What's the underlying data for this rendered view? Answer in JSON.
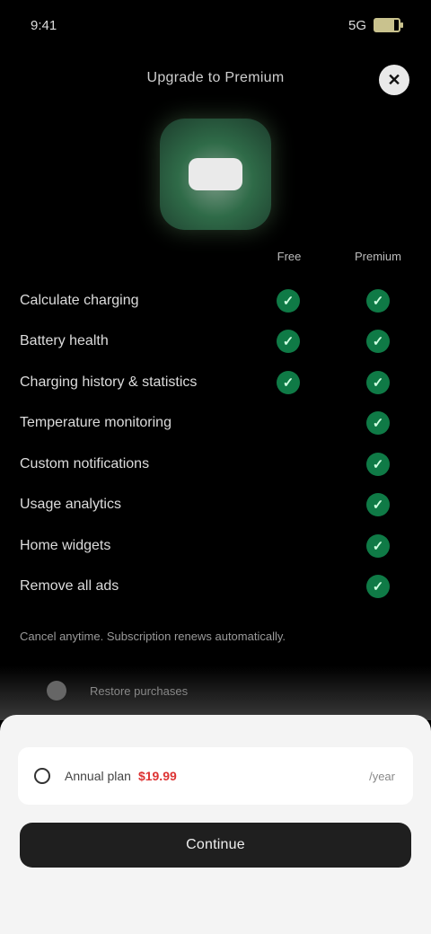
{
  "status_bar": {
    "time": "9:41",
    "signal": "5G",
    "battery_level": 0.8
  },
  "header": {
    "title": "Upgrade to Premium",
    "close_icon": "close-icon"
  },
  "columns": {
    "free_label": "Free",
    "premium_label": "Premium"
  },
  "features": [
    {
      "label": "Calculate charging",
      "free": true,
      "premium": true
    },
    {
      "label": "Battery health",
      "free": true,
      "premium": true
    },
    {
      "label": "Charging history & statistics",
      "free": true,
      "premium": true
    },
    {
      "label": "Temperature monitoring",
      "free": false,
      "premium": true
    },
    {
      "label": "Custom notifications",
      "free": false,
      "premium": true
    },
    {
      "label": "Usage analytics",
      "free": false,
      "premium": true
    },
    {
      "label": "Home widgets",
      "free": false,
      "premium": true
    },
    {
      "label": "Remove all ads",
      "free": false,
      "premium": true
    }
  ],
  "terms_text": "Cancel anytime. Subscription renews automatically.",
  "sheet": {
    "dim_text": "Restore purchases",
    "plan_text": "Annual plan",
    "plan_price": "$19.99",
    "plan_side": "/year",
    "cta_label": "Continue",
    "footer_note": ""
  },
  "colors": {
    "check_green": "#0f7a46",
    "price_red": "#d33333",
    "icon_green": "#2f6b48"
  }
}
